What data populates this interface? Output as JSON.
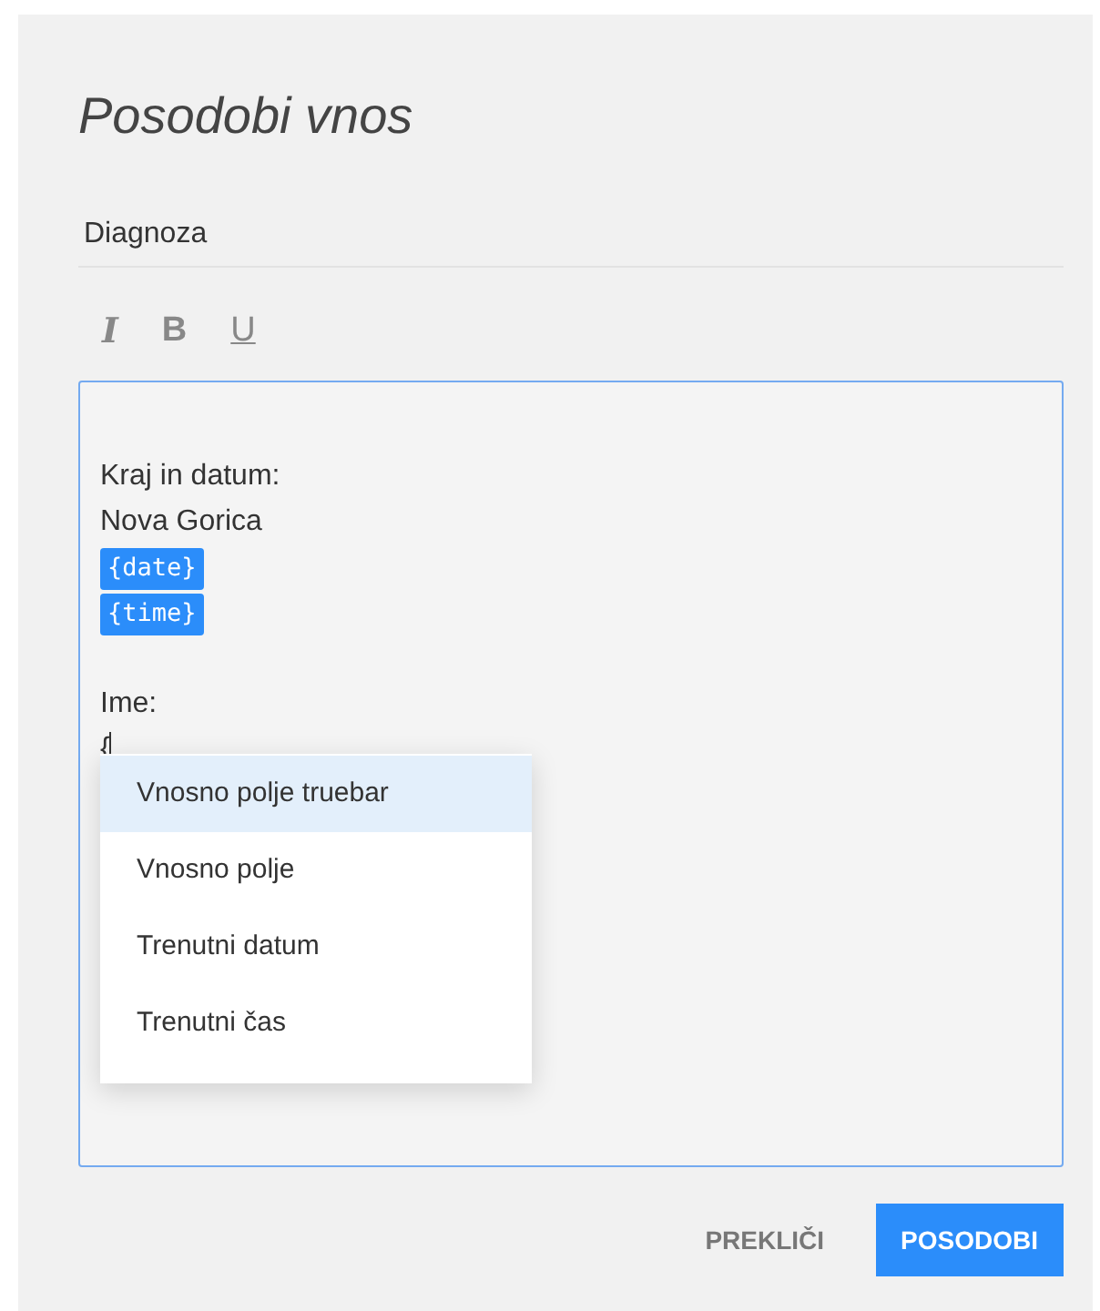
{
  "dialog": {
    "title": "Posodobi vnos"
  },
  "field": {
    "value": "Diagnoza"
  },
  "toolbar": [
    {
      "label": "I",
      "kind": "italic"
    },
    {
      "label": "B",
      "kind": "bold"
    },
    {
      "label": "U",
      "kind": "underline"
    }
  ],
  "editor": {
    "lines": [
      {
        "kind": "blank"
      },
      {
        "kind": "text",
        "text": "Kraj in datum:"
      },
      {
        "kind": "text",
        "text": "Nova Gorica"
      },
      {
        "kind": "tag",
        "text": "{date}"
      },
      {
        "kind": "tag",
        "text": "{time}"
      },
      {
        "kind": "blank"
      },
      {
        "kind": "text",
        "text": "Ime:"
      },
      {
        "kind": "cursor",
        "text": "{"
      }
    ]
  },
  "menu": [
    {
      "label": "Vnosno polje truebar",
      "selected": true
    },
    {
      "label": "Vnosno polje",
      "selected": false
    },
    {
      "label": "Trenutni datum",
      "selected": false
    },
    {
      "label": "Trenutni čas",
      "selected": false
    }
  ],
  "buttons": [
    {
      "label": "PREKLIČI",
      "kind": "flat"
    },
    {
      "label": "POSODOBI",
      "kind": "raised"
    }
  ]
}
